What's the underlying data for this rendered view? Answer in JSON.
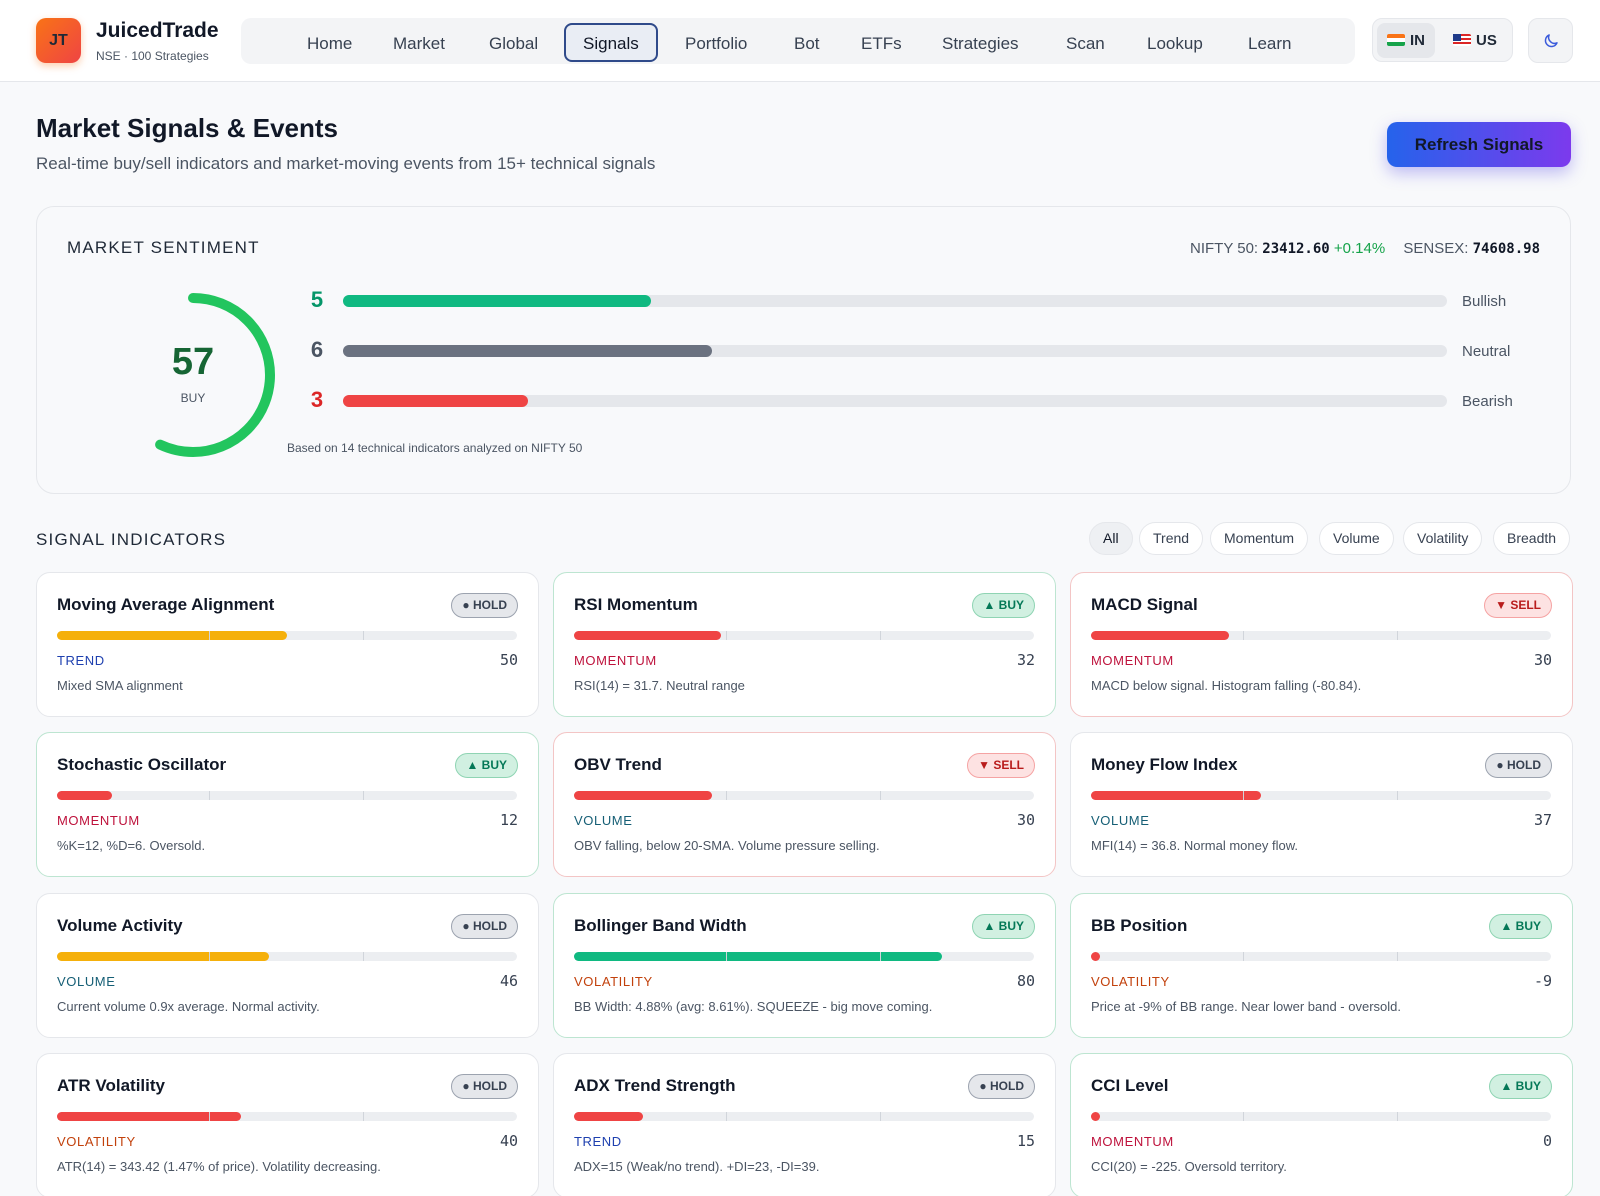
{
  "brand": {
    "initials": "JT",
    "name": "JuicedTrade",
    "subtitle": "NSE · 100 Strategies"
  },
  "nav": {
    "items": [
      {
        "label": "Home"
      },
      {
        "label": "Market"
      },
      {
        "label": "Global"
      },
      {
        "label": "Signals",
        "active": true
      },
      {
        "label": "Portfolio"
      },
      {
        "label": "Bot"
      },
      {
        "label": "ETFs"
      },
      {
        "label": "Strategies"
      },
      {
        "label": "Scan"
      },
      {
        "label": "Lookup"
      },
      {
        "label": "Learn"
      }
    ],
    "regions": [
      {
        "label": "IN",
        "flag": "flag-india-icon",
        "active": true
      },
      {
        "label": "US",
        "flag": "flag-usa-icon"
      }
    ],
    "theme_icon": "moon-icon"
  },
  "page": {
    "title": "Market Signals & Events",
    "subtitle": "Real-time buy/sell indicators and market-moving events from 15+ technical signals",
    "refresh_label": "Refresh Signals"
  },
  "sentiment": {
    "title": "MARKET SENTIMENT",
    "nifty_label": "NIFTY 50:",
    "nifty_value": "23412.60",
    "nifty_change": "+0.14%",
    "sensex_label": "SENSEX:",
    "sensex_value": "74608.98",
    "score": "57",
    "score_level": 0.57,
    "verdict": "BUY",
    "total_indicators": 14,
    "bars": [
      {
        "count": "5",
        "label": "Bullish",
        "color": "#10b981",
        "count_color": "#059669"
      },
      {
        "count": "6",
        "label": "Neutral",
        "color": "#6b7280",
        "count_color": "#4b5563"
      },
      {
        "count": "3",
        "label": "Bearish",
        "color": "#ef4444",
        "count_color": "#dc2626"
      }
    ],
    "note": "Based on 14 technical indicators analyzed on NIFTY 50"
  },
  "signals": {
    "title": "SIGNAL INDICATORS",
    "filters": [
      {
        "label": "All",
        "active": true
      },
      {
        "label": "Trend"
      },
      {
        "label": "Momentum"
      },
      {
        "label": "Volume"
      },
      {
        "label": "Volatility"
      },
      {
        "label": "Breadth"
      }
    ],
    "cards": [
      {
        "name": "Moving Average Alignment",
        "signal": "hold",
        "badge": "● HOLD",
        "category": "TREND",
        "score": "50",
        "level": 0.5,
        "description": "Mixed SMA alignment"
      },
      {
        "name": "RSI Momentum",
        "signal": "buy",
        "badge": "▲ BUY",
        "category": "MOMENTUM",
        "score": "32",
        "level": 0.32,
        "description": "RSI(14) = 31.7. Neutral range"
      },
      {
        "name": "MACD Signal",
        "signal": "sell",
        "badge": "▼ SELL",
        "category": "MOMENTUM",
        "score": "30",
        "level": 0.3,
        "description": "MACD below signal. Histogram falling (-80.84)."
      },
      {
        "name": "Stochastic Oscillator",
        "signal": "buy",
        "badge": "▲ BUY",
        "category": "MOMENTUM",
        "score": "12",
        "level": 0.12,
        "description": "%K=12, %D=6. Oversold."
      },
      {
        "name": "OBV Trend",
        "signal": "sell",
        "badge": "▼ SELL",
        "category": "VOLUME",
        "score": "30",
        "level": 0.3,
        "description": "OBV falling, below 20-SMA. Volume pressure selling."
      },
      {
        "name": "Money Flow Index",
        "signal": "hold",
        "badge": "● HOLD",
        "category": "VOLUME",
        "score": "37",
        "level": 0.37,
        "description": "MFI(14) = 36.8. Normal money flow."
      },
      {
        "name": "Volume Activity",
        "signal": "hold",
        "badge": "● HOLD",
        "category": "VOLUME",
        "score": "46",
        "level": 0.46,
        "description": "Current volume 0.9x average. Normal activity."
      },
      {
        "name": "Bollinger Band Width",
        "signal": "buy",
        "badge": "▲ BUY",
        "category": "VOLATILITY",
        "score": "80",
        "level": 0.8,
        "description": "BB Width: 4.88% (avg: 8.61%). SQUEEZE - big move coming."
      },
      {
        "name": "BB Position",
        "signal": "buy",
        "badge": "▲ BUY",
        "category": "VOLATILITY",
        "score": "-9",
        "level": 0.0,
        "description": "Price at -9% of BB range. Near lower band - oversold."
      },
      {
        "name": "ATR Volatility",
        "signal": "hold",
        "badge": "● HOLD",
        "category": "VOLATILITY",
        "score": "40",
        "level": 0.4,
        "description": "ATR(14) = 343.42 (1.47% of price). Volatility decreasing."
      },
      {
        "name": "ADX Trend Strength",
        "signal": "hold",
        "badge": "● HOLD",
        "category": "TREND",
        "score": "15",
        "level": 0.15,
        "description": "ADX=15 (Weak/no trend). +DI=23, -DI=39."
      },
      {
        "name": "CCI Level",
        "signal": "buy",
        "badge": "▲ BUY",
        "category": "MOMENTUM",
        "score": "0",
        "level": 0.0,
        "description": "CCI(20) = -225. Oversold territory."
      }
    ],
    "category_colors": {
      "TREND": "#1e40af",
      "MOMENTUM": "#be123c",
      "VOLUME": "#155e75",
      "VOLATILITY": "#c2410c"
    },
    "fill_colors": {
      "high": "#10b981",
      "mid": "#f5b00b",
      "low": "#ef4444"
    }
  }
}
